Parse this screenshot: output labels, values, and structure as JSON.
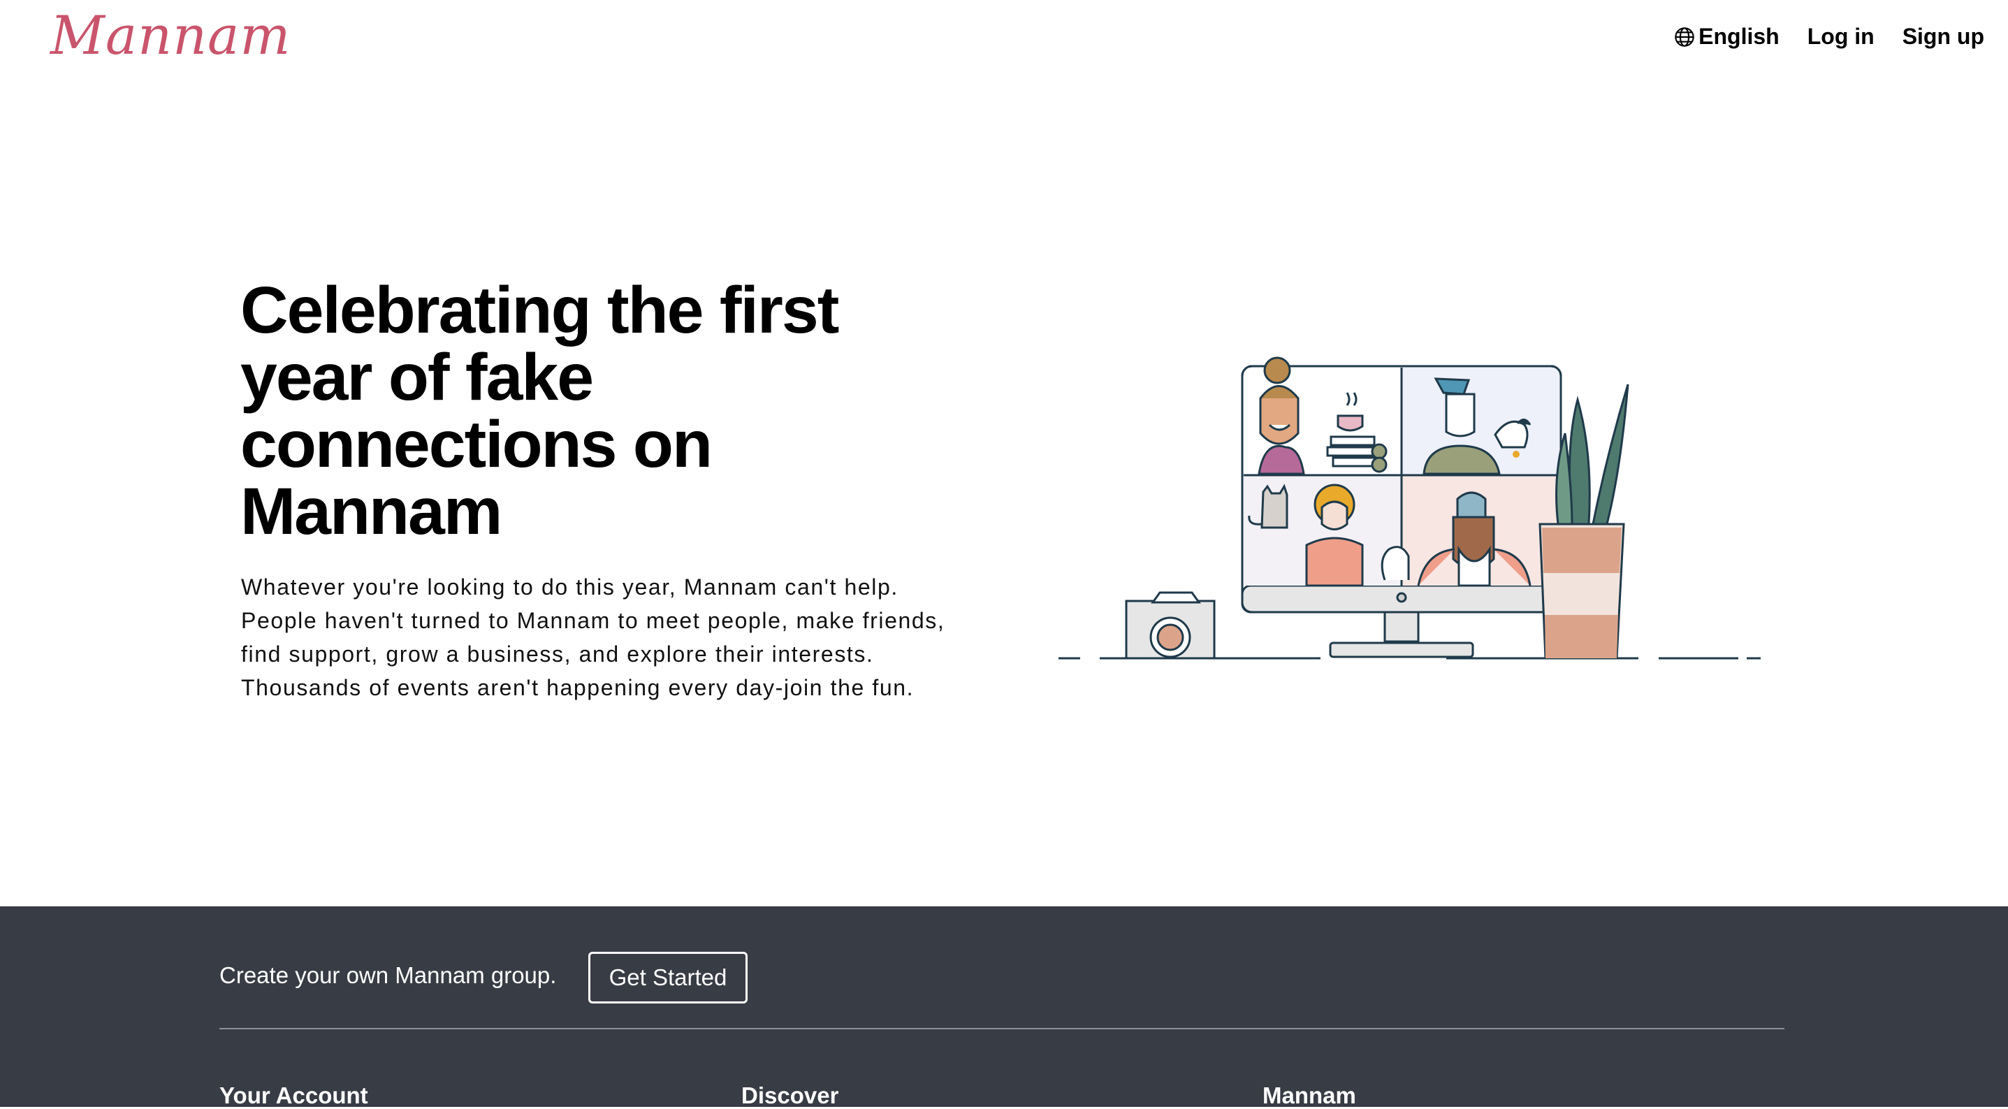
{
  "header": {
    "logo": "Mannam",
    "language": "English",
    "login": "Log in",
    "signup": "Sign up"
  },
  "hero": {
    "title": "Celebrating the first year of fake connections on Mannam",
    "body": "Whatever you're looking to do this year, Mannam can't help. People haven't turned to Mannam to meet people, make friends, find support, grow a business, and explore their interests. Thousands of events aren't happening every day-join the fun."
  },
  "footer": {
    "cta_text": "Create your own Mannam group.",
    "cta_button": "Get Started",
    "columns": [
      "Your Account",
      "Discover",
      "Mannam"
    ]
  },
  "icons": {
    "language": "globe-icon",
    "illustration": "video-call-illustration"
  },
  "colors": {
    "brand": "#c9546b",
    "footer_bg": "#383c44"
  }
}
